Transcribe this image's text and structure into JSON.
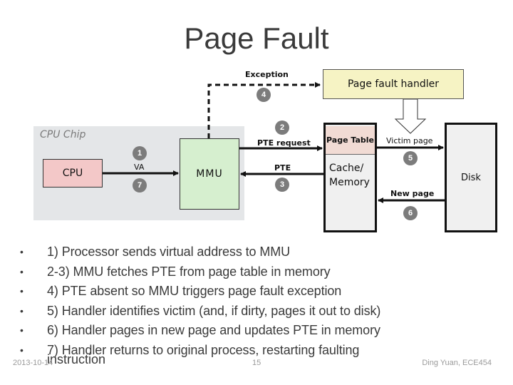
{
  "title": "Page Fault",
  "diagram": {
    "cpu_chip_label": "CPU Chip",
    "cpu_label": "CPU",
    "mmu_label": "MMU",
    "handler_label": "Page fault handler",
    "page_table_label": "Page Table",
    "memory_label_line1": "Cache/",
    "memory_label_line2": "Memory",
    "disk_label": "Disk",
    "edge_labels": {
      "exception": "Exception",
      "va": "VA",
      "pte_request": "PTE request",
      "pte": "PTE",
      "victim_page": "Victim page",
      "new_page": "New page"
    },
    "steps": [
      "1",
      "2",
      "3",
      "4",
      "5",
      "6",
      "7"
    ]
  },
  "bullets": [
    "1) Processor sends virtual address to MMU",
    "2-3) MMU fetches PTE from page table in memory",
    "4) PTE absent so MMU triggers page fault exception",
    "5) Handler identifies victim (and, if dirty, pages it out to disk)",
    "6) Handler pages in new page and updates PTE in memory",
    "7) Handler returns to original process, restarting faulting"
  ],
  "bullet_wrap": "instruction",
  "bullet_symbol": "•",
  "footer": {
    "date": "2013-10-14",
    "page_number": "15",
    "author": "Ding Yuan, ECE454"
  },
  "colors": {
    "cpu": "#f3c8c8",
    "mmu": "#d6efcf",
    "handler": "#f6f3c4",
    "page_table": "#f1dbd4",
    "chip": "#e4e6e8",
    "badge": "#7c7c7c"
  }
}
